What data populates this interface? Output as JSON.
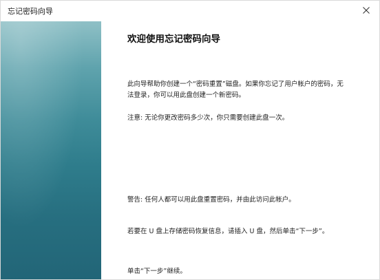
{
  "window": {
    "title": "忘记密码向导",
    "close_symbol": "✕"
  },
  "icons": {
    "close": "close-icon"
  },
  "colors": {
    "panel_top": "#8fc0c6",
    "panel_bottom": "#226577"
  },
  "content": {
    "heading": "欢迎使用忘记密码向导",
    "intro": "此向导帮助你创建一个“密码重置”磁盘。如果你忘记了用户帐户的密码，无法登录，你可以用此盘创建一个新密码。",
    "note": "注意: 无论你更改密码多少次，你只需要创建此盘一次。",
    "warning": "警告: 任何人都可以用此盘重置密码，并由此访问此帐户。",
    "insert": "若要在 U 盘上存储密码恢复信息，请插入 U 盘，然后单击“下一步”。",
    "continue": "单击“下一步”继续。"
  }
}
